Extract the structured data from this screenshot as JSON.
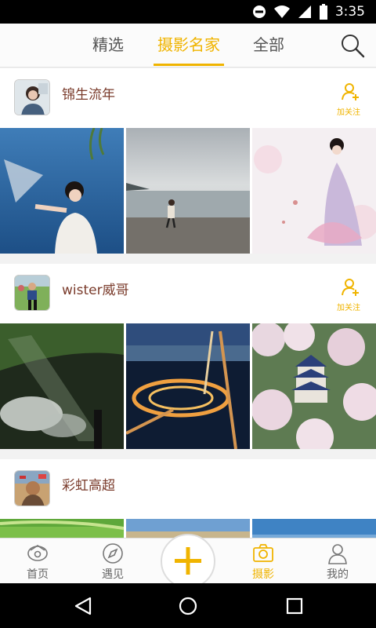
{
  "status_bar": {
    "time": "3:35",
    "icons": [
      "do-not-disturb-icon",
      "wifi-icon",
      "signal-icon",
      "battery-icon"
    ]
  },
  "tabs": [
    {
      "label": "精选",
      "active": false
    },
    {
      "label": "摄影名家",
      "active": true
    },
    {
      "label": "全部",
      "active": false
    }
  ],
  "search_icon": "search-icon",
  "colors": {
    "accent": "#f0b400",
    "username": "#7a3b2b",
    "nav_text": "#666666"
  },
  "feed": [
    {
      "username": "锦生流年",
      "follow_label": "加关注",
      "photos": 3
    },
    {
      "username": "wister威哥",
      "follow_label": "加关注",
      "photos": 3
    },
    {
      "username": "彩虹高超",
      "follow_label": "",
      "photos": 3
    }
  ],
  "bottom_nav": [
    {
      "label": "首页",
      "icon": "home-icon",
      "active": false
    },
    {
      "label": "遇见",
      "icon": "compass-icon",
      "active": false
    },
    {
      "label": "",
      "icon": "plus-icon",
      "active": false
    },
    {
      "label": "摄影",
      "icon": "camera-icon",
      "active": true
    },
    {
      "label": "我的",
      "icon": "user-icon",
      "active": false
    }
  ],
  "android_nav": [
    "back-icon",
    "home-circle-icon",
    "recents-icon"
  ]
}
